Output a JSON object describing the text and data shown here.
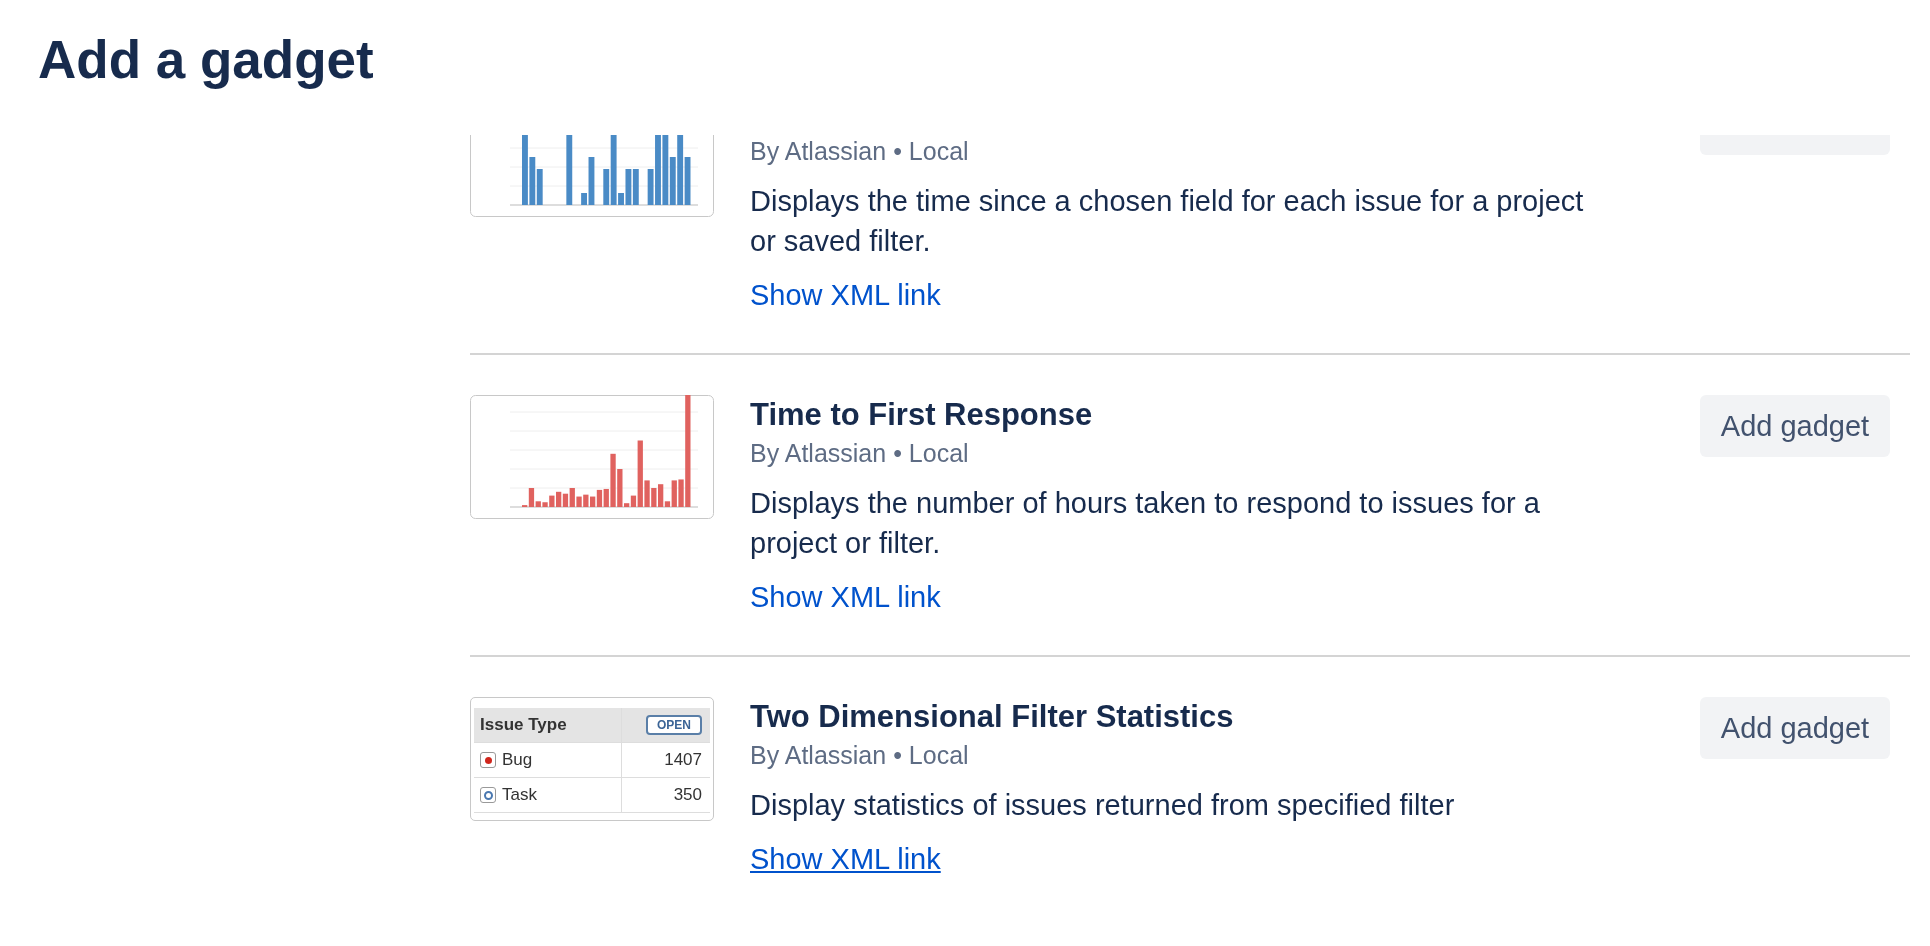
{
  "page_title": "Add a gadget",
  "gadgets": [
    {
      "author": "By Atlassian • Local",
      "description": "Displays the time since a chosen field for each issue for a project or saved filter.",
      "link": "Show XML link",
      "link_hovered": false,
      "thumbnail": {
        "kind": "bar_chart",
        "color": "#4a8bc6"
      }
    },
    {
      "title": "Time to First Response",
      "author": "By Atlassian • Local",
      "description": "Displays the number of hours taken to respond to issues for a project or filter.",
      "link": "Show XML link",
      "link_hovered": false,
      "button": "Add gadget",
      "thumbnail": {
        "kind": "bar_chart",
        "color": "#e0625f"
      }
    },
    {
      "title": "Two Dimensional Filter Statistics",
      "author": "By Atlassian • Local",
      "description": "Display statistics of issues returned from specified filter",
      "link": "Show XML link",
      "link_hovered": true,
      "button": "Add gadget",
      "thumbnail": {
        "kind": "table",
        "header": "Issue Type",
        "badge": "OPEN",
        "rows": [
          {
            "kind": "bug",
            "label": "Bug",
            "count": "1407"
          },
          {
            "kind": "task",
            "label": "Task",
            "count": "350"
          }
        ]
      }
    }
  ]
}
